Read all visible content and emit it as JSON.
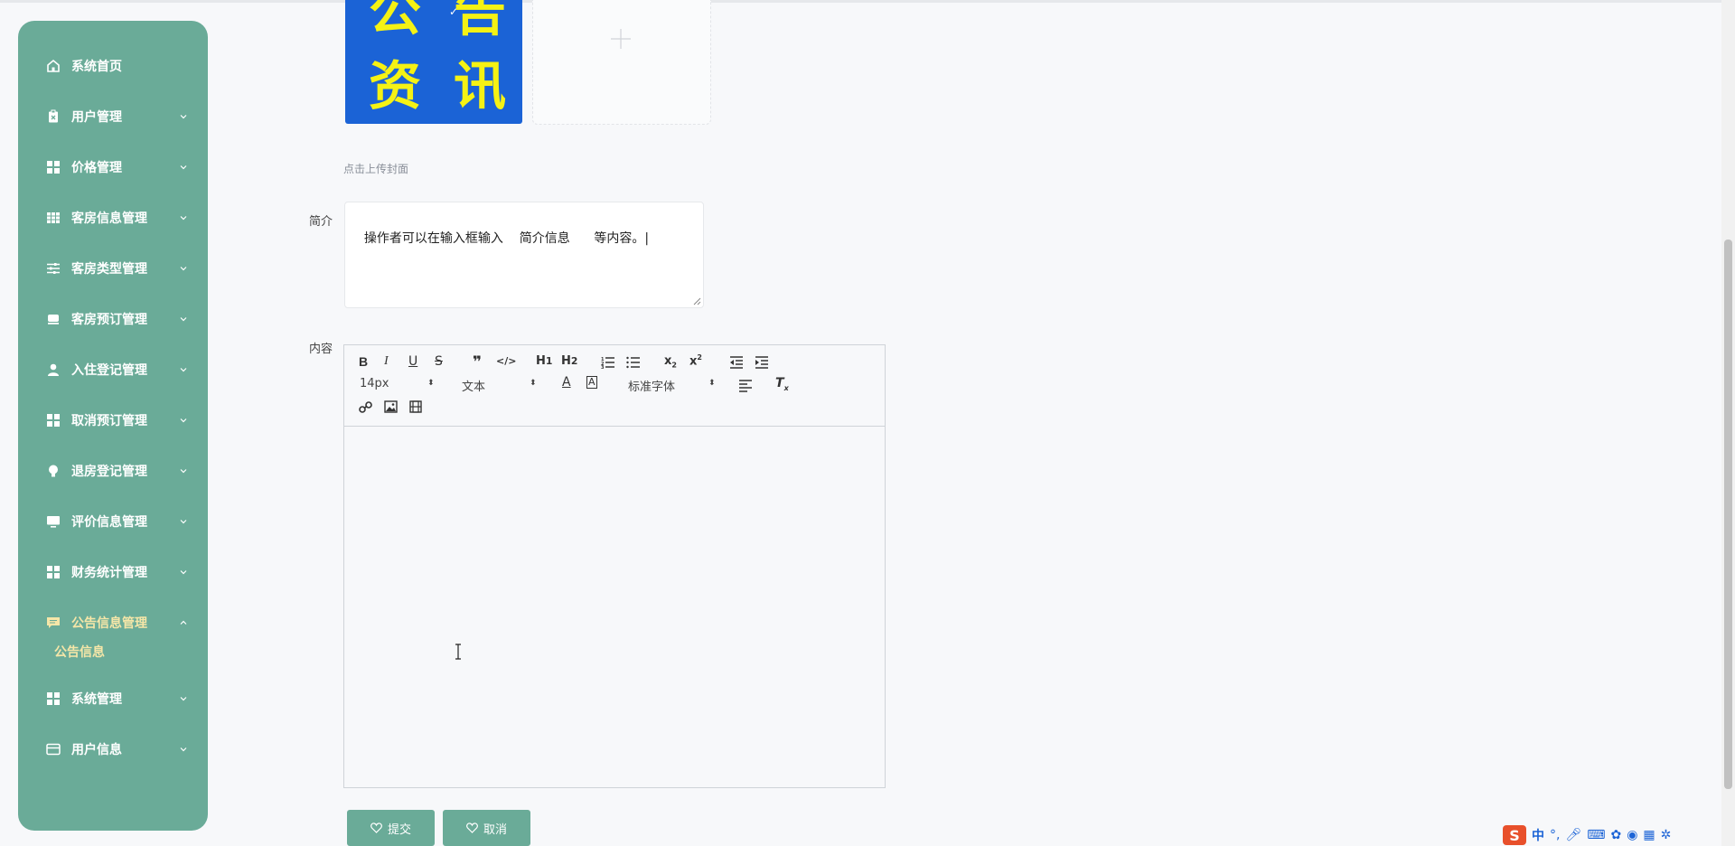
{
  "sidebar": {
    "items": [
      {
        "label": "系统首页",
        "icon": "home-icon"
      },
      {
        "label": "用户管理",
        "icon": "clipboard-icon"
      },
      {
        "label": "价格管理",
        "icon": "grid-icon"
      },
      {
        "label": "客房信息管理",
        "icon": "table-icon"
      },
      {
        "label": "客房类型管理",
        "icon": "sliders-icon"
      },
      {
        "label": "客房预订管理",
        "icon": "bed-icon"
      },
      {
        "label": "入住登记管理",
        "icon": "user-icon"
      },
      {
        "label": "取消预订管理",
        "icon": "grid-icon"
      },
      {
        "label": "退房登记管理",
        "icon": "bulb-icon"
      },
      {
        "label": "评价信息管理",
        "icon": "monitor-icon"
      },
      {
        "label": "财务统计管理",
        "icon": "grid-icon"
      },
      {
        "label": "公告信息管理",
        "icon": "message-icon"
      },
      {
        "label": "系统管理",
        "icon": "grid-icon"
      },
      {
        "label": "用户信息",
        "icon": "card-icon"
      }
    ],
    "sub_item": "公告信息"
  },
  "cover": {
    "image_chars": [
      "公",
      "告",
      "资",
      "讯"
    ],
    "hint": "点击上传封面"
  },
  "form": {
    "intro_label": "简介",
    "intro_value": "操作者可以在输入框输入    简介信息      等内容。|",
    "content_label": "内容"
  },
  "editor": {
    "font_size": "14px",
    "header_select": "文本",
    "font_family": "标准字体"
  },
  "buttons": {
    "submit": "提交",
    "cancel": "取消"
  },
  "ime": {
    "lang": "中"
  },
  "colors": {
    "sidebar_bg": "#6aab98",
    "active_text": "#f5e6a8",
    "cover_bg": "#1b63d6",
    "cover_text": "#f5f214"
  }
}
